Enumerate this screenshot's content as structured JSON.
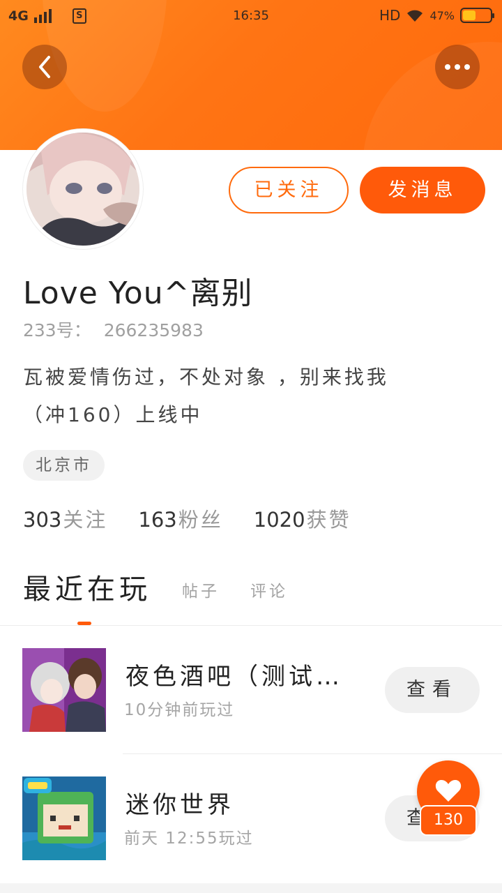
{
  "status_bar": {
    "network": "4G",
    "time": "16:35",
    "hd": "HD",
    "battery_text": "47%",
    "battery_level": 0.47,
    "battery_color": "#ffc21a"
  },
  "header": {
    "back_icon": "chevron-left-icon",
    "more_icon": "more-horizontal-icon",
    "accent_color": "#ff6a0c"
  },
  "profile": {
    "follow_label": "已关注",
    "message_label": "发消息",
    "username": "Love You^离别",
    "uid_label": "233号：",
    "uid_value": "266235983",
    "bio_line1": "瓦被爱情伤过，不处对象 ，别来找我",
    "bio_line2": "（冲160）上线中",
    "location": "北京市",
    "stats": [
      {
        "value": "303",
        "label": "关注"
      },
      {
        "value": "163",
        "label": "粉丝"
      },
      {
        "value": "1020",
        "label": "获赞"
      }
    ]
  },
  "tabs": [
    {
      "label": "最近在玩",
      "active": true
    },
    {
      "label": "帖子",
      "active": false
    },
    {
      "label": "评论",
      "active": false
    }
  ],
  "games": [
    {
      "title": "夜色酒吧（测试…",
      "subtitle": "10分钟前玩过",
      "button": "查看"
    },
    {
      "title": "迷你世界",
      "subtitle": "前天 12:55玩过",
      "button": "查看"
    }
  ],
  "like": {
    "icon": "heart-icon",
    "count": "130"
  }
}
